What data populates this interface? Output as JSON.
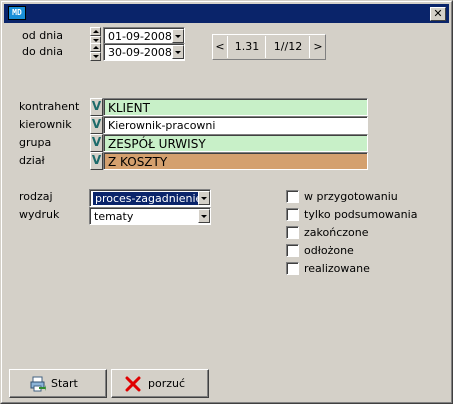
{
  "titlebar": {
    "icon_text": "MD",
    "close_label": "✕"
  },
  "dates": {
    "from_label": "od dnia",
    "from_value": "01-09-2008",
    "to_label": "do dnia",
    "to_value": "30-09-2008"
  },
  "navigator": {
    "prev": "<",
    "position": "1.31",
    "page": "1//12",
    "next": ">"
  },
  "filters": [
    {
      "label": "kontrahent",
      "button": "V",
      "value": "KLIENT",
      "color": "#c8f0c8"
    },
    {
      "label": "kierownik",
      "button": "V",
      "value": "Kierownik-pracowni",
      "color": "#ffffff"
    },
    {
      "label": "grupa",
      "button": "V",
      "value": "ZESPÓŁ URWISY",
      "color": "#c8f0c8"
    },
    {
      "label": "dział",
      "button": "V",
      "value": "Z KOSZTY",
      "color": "#d4a06e"
    }
  ],
  "selects": {
    "rodzaj_label": "rodzaj",
    "rodzaj_value": "proces-zagadnienie",
    "wydruk_label": "wydruk",
    "wydruk_value": "tematy"
  },
  "status_checkboxes": [
    {
      "label": "w przygotowaniu",
      "checked": false
    },
    {
      "label": "tylko podsumowania",
      "checked": false
    },
    {
      "label": "zakończone",
      "checked": false
    },
    {
      "label": "odłożone",
      "checked": false
    },
    {
      "label": "realizowane",
      "checked": false
    }
  ],
  "buttons": {
    "start_label": "Start",
    "cancel_label": "porzuć"
  },
  "colors": {
    "titlebar": "#0a246a",
    "cancel_icon": "#e00000"
  }
}
